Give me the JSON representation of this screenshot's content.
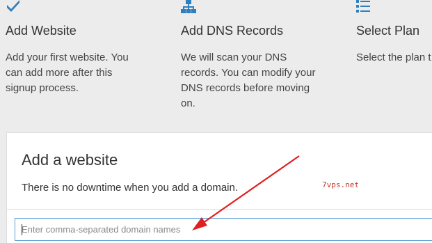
{
  "steps": [
    {
      "icon": "checkmark-icon",
      "title": "Add Website",
      "description": "Add your first website. You can add more after this signup process."
    },
    {
      "icon": "sitemap-icon",
      "title": "Add DNS Records",
      "description": "We will scan your DNS records. You can modify your DNS records before moving on."
    },
    {
      "icon": "list-icon",
      "title": "Select Plan",
      "description": "Select the plan t your needs."
    }
  ],
  "card": {
    "title": "Add a website",
    "subtitle": "There is no downtime when you add a domain.",
    "input": {
      "placeholder": "Enter comma-separated domain names",
      "value": ""
    }
  },
  "watermark": "7vps.net",
  "colors": {
    "icon": "#2f7fbf",
    "input_border": "#5a9fd6",
    "arrow": "#e02020",
    "watermark": "#c0392b",
    "background": "#ececec"
  }
}
